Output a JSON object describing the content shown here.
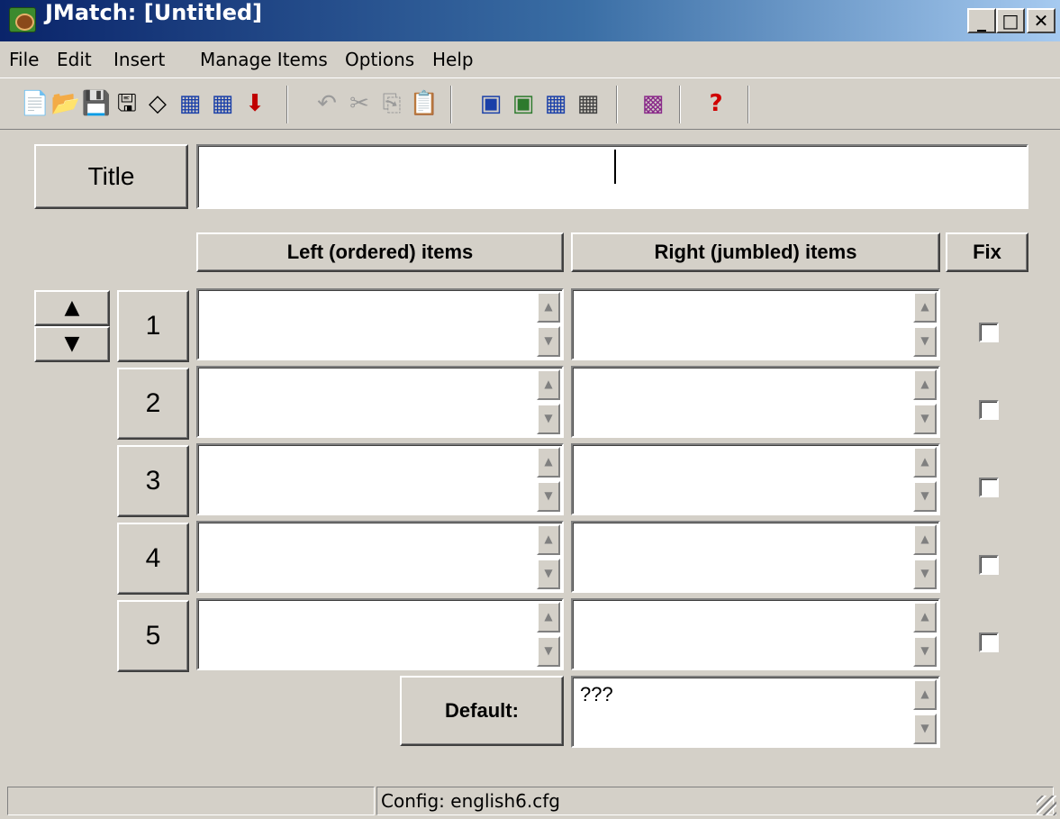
{
  "window": {
    "title": "JMatch: [Untitled]",
    "minimize": "_",
    "maximize": "□",
    "close": "✕"
  },
  "menu": [
    "File",
    "Edit",
    "Insert",
    "Manage Items",
    "Options",
    "Help"
  ],
  "toolbar": {
    "icons": [
      "new-file-icon",
      "open-folder-icon",
      "save-icon",
      "save-as-icon",
      "eraser-icon",
      "web-page-v6-icon",
      "web-page-v6-alt-icon",
      "down-arrow-icon",
      "undo-icon",
      "cut-icon",
      "copy-icon",
      "paste-icon",
      "insert-picture-icon",
      "insert-web-icon",
      "link-icon",
      "insert-media-icon",
      "config-icon",
      "help-icon"
    ],
    "glyphs": [
      "📄",
      "📂",
      "💾",
      "🖫",
      "◇",
      "▦",
      "▦",
      "⬇",
      "↶",
      "✂",
      "⎘",
      "📋",
      "▣",
      "▣",
      "▦",
      "▦",
      "▩",
      "?"
    ]
  },
  "title_label": "Title",
  "title_value": "",
  "headers": {
    "left": "Left (ordered) items",
    "right": "Right (jumbled) items",
    "fix": "Fix"
  },
  "rows": [
    {
      "number": "1",
      "left": "",
      "right": "",
      "fixed": false
    },
    {
      "number": "2",
      "left": "",
      "right": "",
      "fixed": false
    },
    {
      "number": "3",
      "left": "",
      "right": "",
      "fixed": false
    },
    {
      "number": "4",
      "left": "",
      "right": "",
      "fixed": false
    },
    {
      "number": "5",
      "left": "",
      "right": "",
      "fixed": false
    }
  ],
  "move_up": "▲",
  "move_down": "▼",
  "default_label": "Default:",
  "default_value": "???",
  "status": {
    "left": "",
    "config": "Config: english6.cfg"
  }
}
